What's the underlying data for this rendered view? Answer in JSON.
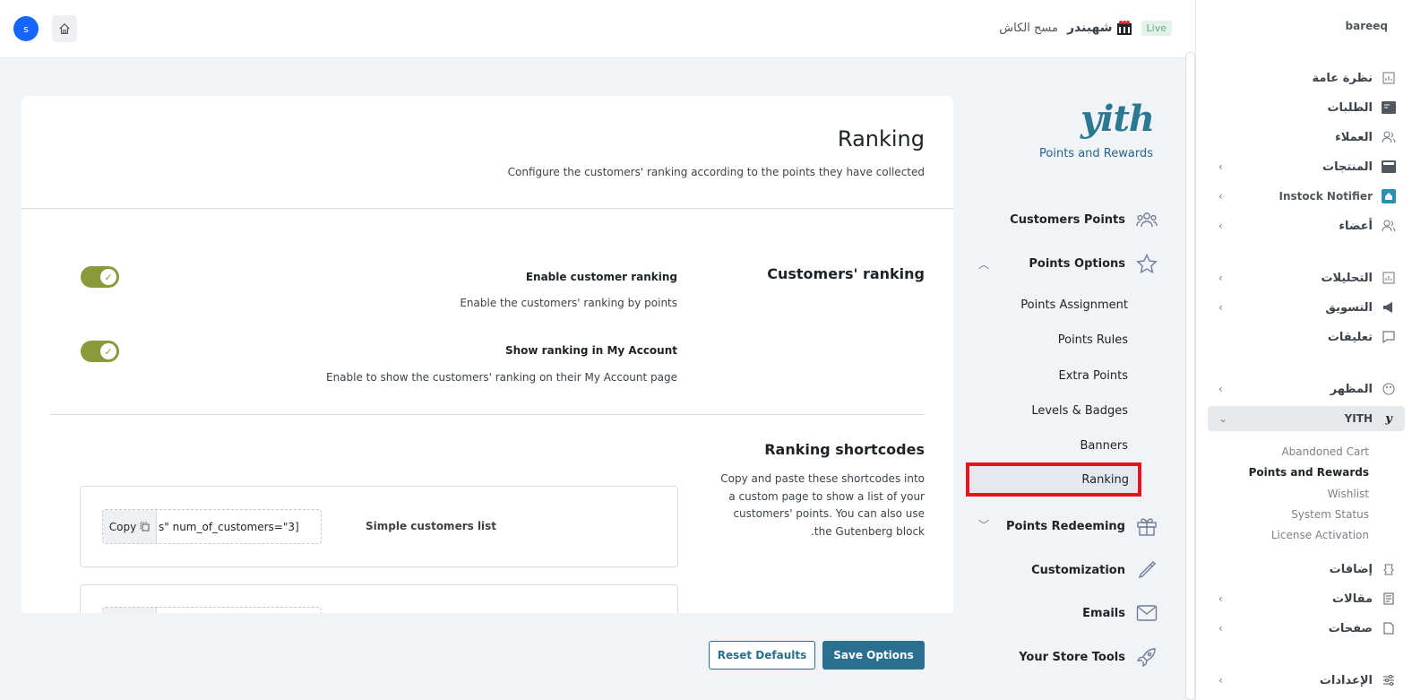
{
  "topbar": {
    "avatar_letter": "s",
    "cash_label": "مسح الكاش",
    "store_name": "شهبندر",
    "live_badge": "Live"
  },
  "admin_sidebar": {
    "brand": "bareeq",
    "items": [
      {
        "label": "نظرة عامة",
        "icon": "chart-icon",
        "has_chevron": false
      },
      {
        "label": "الطلبات",
        "icon": "orders-icon",
        "has_chevron": false
      },
      {
        "label": "العملاء",
        "icon": "users-icon",
        "has_chevron": false
      },
      {
        "label": "المنتجات",
        "icon": "box-icon",
        "has_chevron": true
      },
      {
        "label": "Instock Notifier",
        "icon": "notifier-icon",
        "has_chevron": true
      },
      {
        "label": "أعضاء",
        "icon": "members-icon",
        "has_chevron": true
      },
      {
        "label": "التحليلات",
        "icon": "analytics-icon",
        "has_chevron": true
      },
      {
        "label": "التسويق",
        "icon": "megaphone-icon",
        "has_chevron": true
      },
      {
        "label": "تعليقات",
        "icon": "comments-icon",
        "has_chevron": false
      },
      {
        "label": "المظهر",
        "icon": "palette-icon",
        "has_chevron": true
      },
      {
        "label": "YITH",
        "icon": "yith-icon",
        "has_chevron": true
      },
      {
        "label": "إضافات",
        "icon": "plugin-icon",
        "has_chevron": false
      },
      {
        "label": "مقالات",
        "icon": "posts-icon",
        "has_chevron": true
      },
      {
        "label": "صفحات",
        "icon": "pages-icon",
        "has_chevron": true
      },
      {
        "label": "الإعدادات",
        "icon": "settings-icon",
        "has_chevron": true
      }
    ],
    "yith_submenu": [
      "Abandoned Cart",
      "Points and Rewards",
      "Wishlist",
      "System Status",
      "License Activation"
    ]
  },
  "plugin_nav": {
    "logo_text": "yith",
    "title": "Points and Rewards",
    "items": {
      "customers_points": "Customers Points",
      "points_options": "Points Options",
      "points_redeeming": "Points Redeeming",
      "customization": "Customization",
      "emails": "Emails",
      "store_tools": "Your Store Tools"
    },
    "sub_items": [
      "Points Assignment",
      "Points Rules",
      "Extra Points",
      "Levels & Badges",
      "Banners",
      "Ranking"
    ]
  },
  "page": {
    "title": "Ranking",
    "description": "Configure the customers' ranking according to the points they have collected",
    "sections": {
      "ranking_title": "Customers' ranking",
      "enable_label": "Enable customer ranking",
      "enable_desc": "Enable the customers' ranking by points",
      "enable_value": true,
      "show_label": "Show ranking in My Account",
      "show_desc": "Enable to show the customers' ranking on their My Account page",
      "show_value": true,
      "shortcodes_title": "Ranking shortcodes",
      "shortcodes_desc": "Copy and paste these shortcodes into a custom page to show a list of your customers' points. You can also use the Gutenberg block."
    },
    "shortcodes": [
      {
        "name": "Simple customers list",
        "copy_label": "Copy",
        "code": "s\" num_of_customers=\"3]"
      }
    ]
  },
  "footer": {
    "reset_label": "Reset Defaults",
    "save_label": "Save Options"
  },
  "colors": {
    "accent": "#2a6f8f",
    "toggle_on": "#8a9a3a",
    "highlight": "#e8111c"
  }
}
